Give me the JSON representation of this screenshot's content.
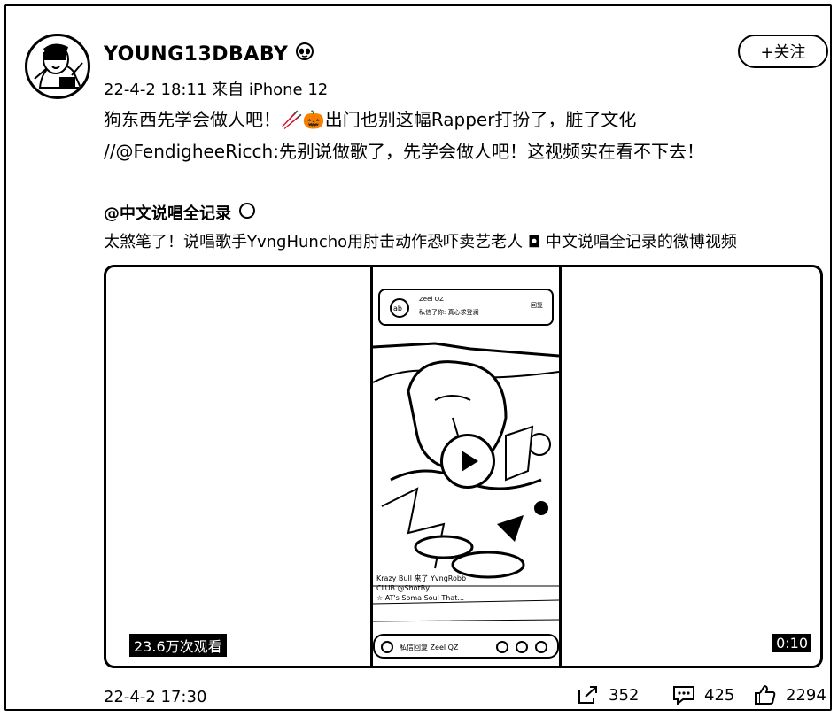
{
  "post": {
    "username": "YOUNG13DBABY",
    "meta": "22-4-2 18:11 来自 iPhone 12",
    "follow_label": "+关注",
    "text_line1": "狗东西先学会做人吧！🥢🎃出门也别这幅Rapper打扮了，脏了文化",
    "text_line2": "//@FendigheeRicch:先别说做歌了，先学会做人吧！这视频实在看不下去！"
  },
  "repost": {
    "author": "@中文说唱全记录",
    "text": "太煞笔了！说唱歌手YvngHuncho用肘击动作恐吓卖艺老人 ◘ 中文说唱全记录的微博视频"
  },
  "video": {
    "views": "23.6万次观看",
    "duration": "0:10",
    "phone": {
      "notif_name": "Zeel QZ",
      "notif_msg": "私信了你: 真心求登澜",
      "notif_reply": "回复",
      "live_line1": "Krazy Bull 来了 YvngRobb",
      "live_line2": "CLUB @ShotBy...",
      "live_line3": "☆ AT's Soma Soul That...",
      "bottom_text": "私信回复 Zeel QZ"
    }
  },
  "footer": {
    "date": "22-4-2 17:30",
    "share_count": "352",
    "comment_count": "425",
    "like_count": "2294"
  }
}
